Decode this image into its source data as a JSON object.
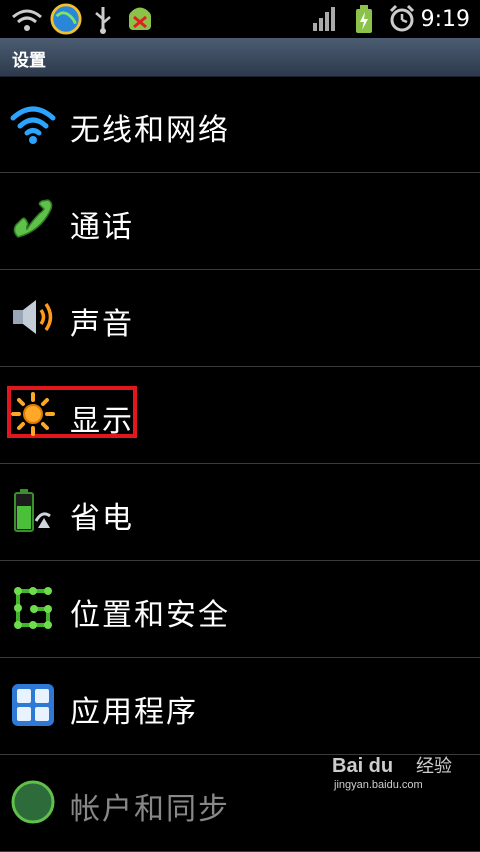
{
  "status_bar": {
    "time": "9:19",
    "icons": [
      "wifi-icon",
      "sync-icon",
      "usb-icon",
      "android-debug-icon",
      "signal-icon",
      "battery-icon",
      "alarm-icon"
    ]
  },
  "title_bar": {
    "title": "设置"
  },
  "settings": {
    "items": [
      {
        "label": "无线和网络",
        "icon": "wifi-icon"
      },
      {
        "label": "通话",
        "icon": "phone-icon"
      },
      {
        "label": "声音",
        "icon": "speaker-icon"
      },
      {
        "label": "显示",
        "icon": "brightness-icon",
        "highlighted": true
      },
      {
        "label": "省电",
        "icon": "battery-saver-icon"
      },
      {
        "label": "位置和安全",
        "icon": "location-security-icon"
      },
      {
        "label": "应用程序",
        "icon": "applications-icon"
      },
      {
        "label": "帐户和同步",
        "icon": "accounts-icon"
      }
    ]
  },
  "watermark": {
    "logo": "Bai du",
    "text": "经验",
    "url": "jingyan.baidu.com"
  },
  "colors": {
    "highlight": "#e0181e",
    "title_bar": "#3a4a60"
  }
}
